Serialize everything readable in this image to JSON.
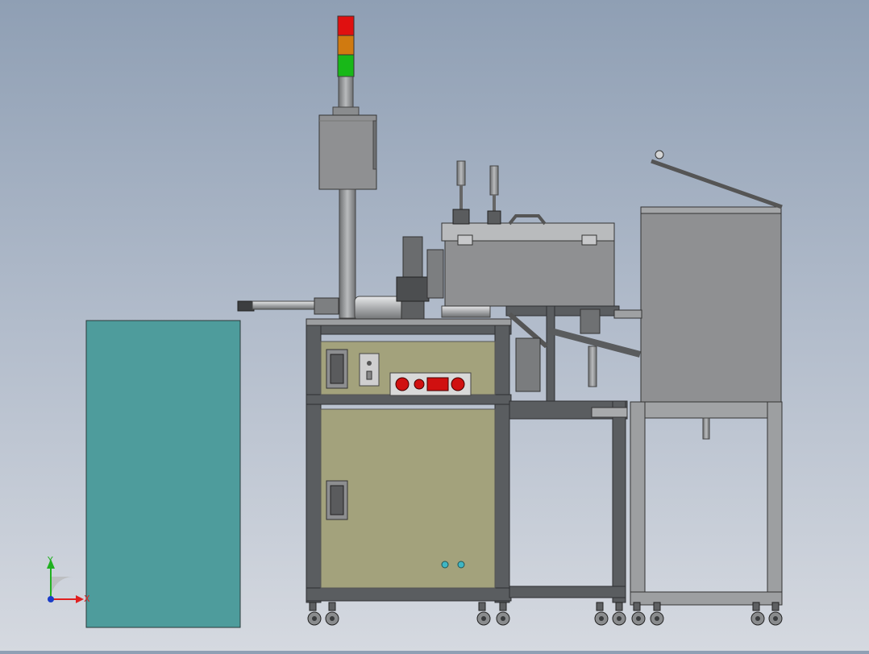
{
  "view": {
    "background_top": "#8f9fb4",
    "background_bottom": "#d5d9e0"
  },
  "triad": {
    "x_label": "X",
    "y_label": "Y",
    "x_color": "#e02020",
    "y_color": "#20b020",
    "origin_color": "#1a3cc8"
  },
  "model": {
    "frame_color": "#5a5d60",
    "cabinet_color": "#a3a27c",
    "panel_color": "#8f9092",
    "block_color": "#4e9c9c",
    "tower_light": {
      "top": "#e01010",
      "middle": "#d07a10",
      "bottom": "#18b818"
    },
    "control_knobs_color": "#d01010",
    "indicator_dots_color": "#3fb6c4"
  }
}
